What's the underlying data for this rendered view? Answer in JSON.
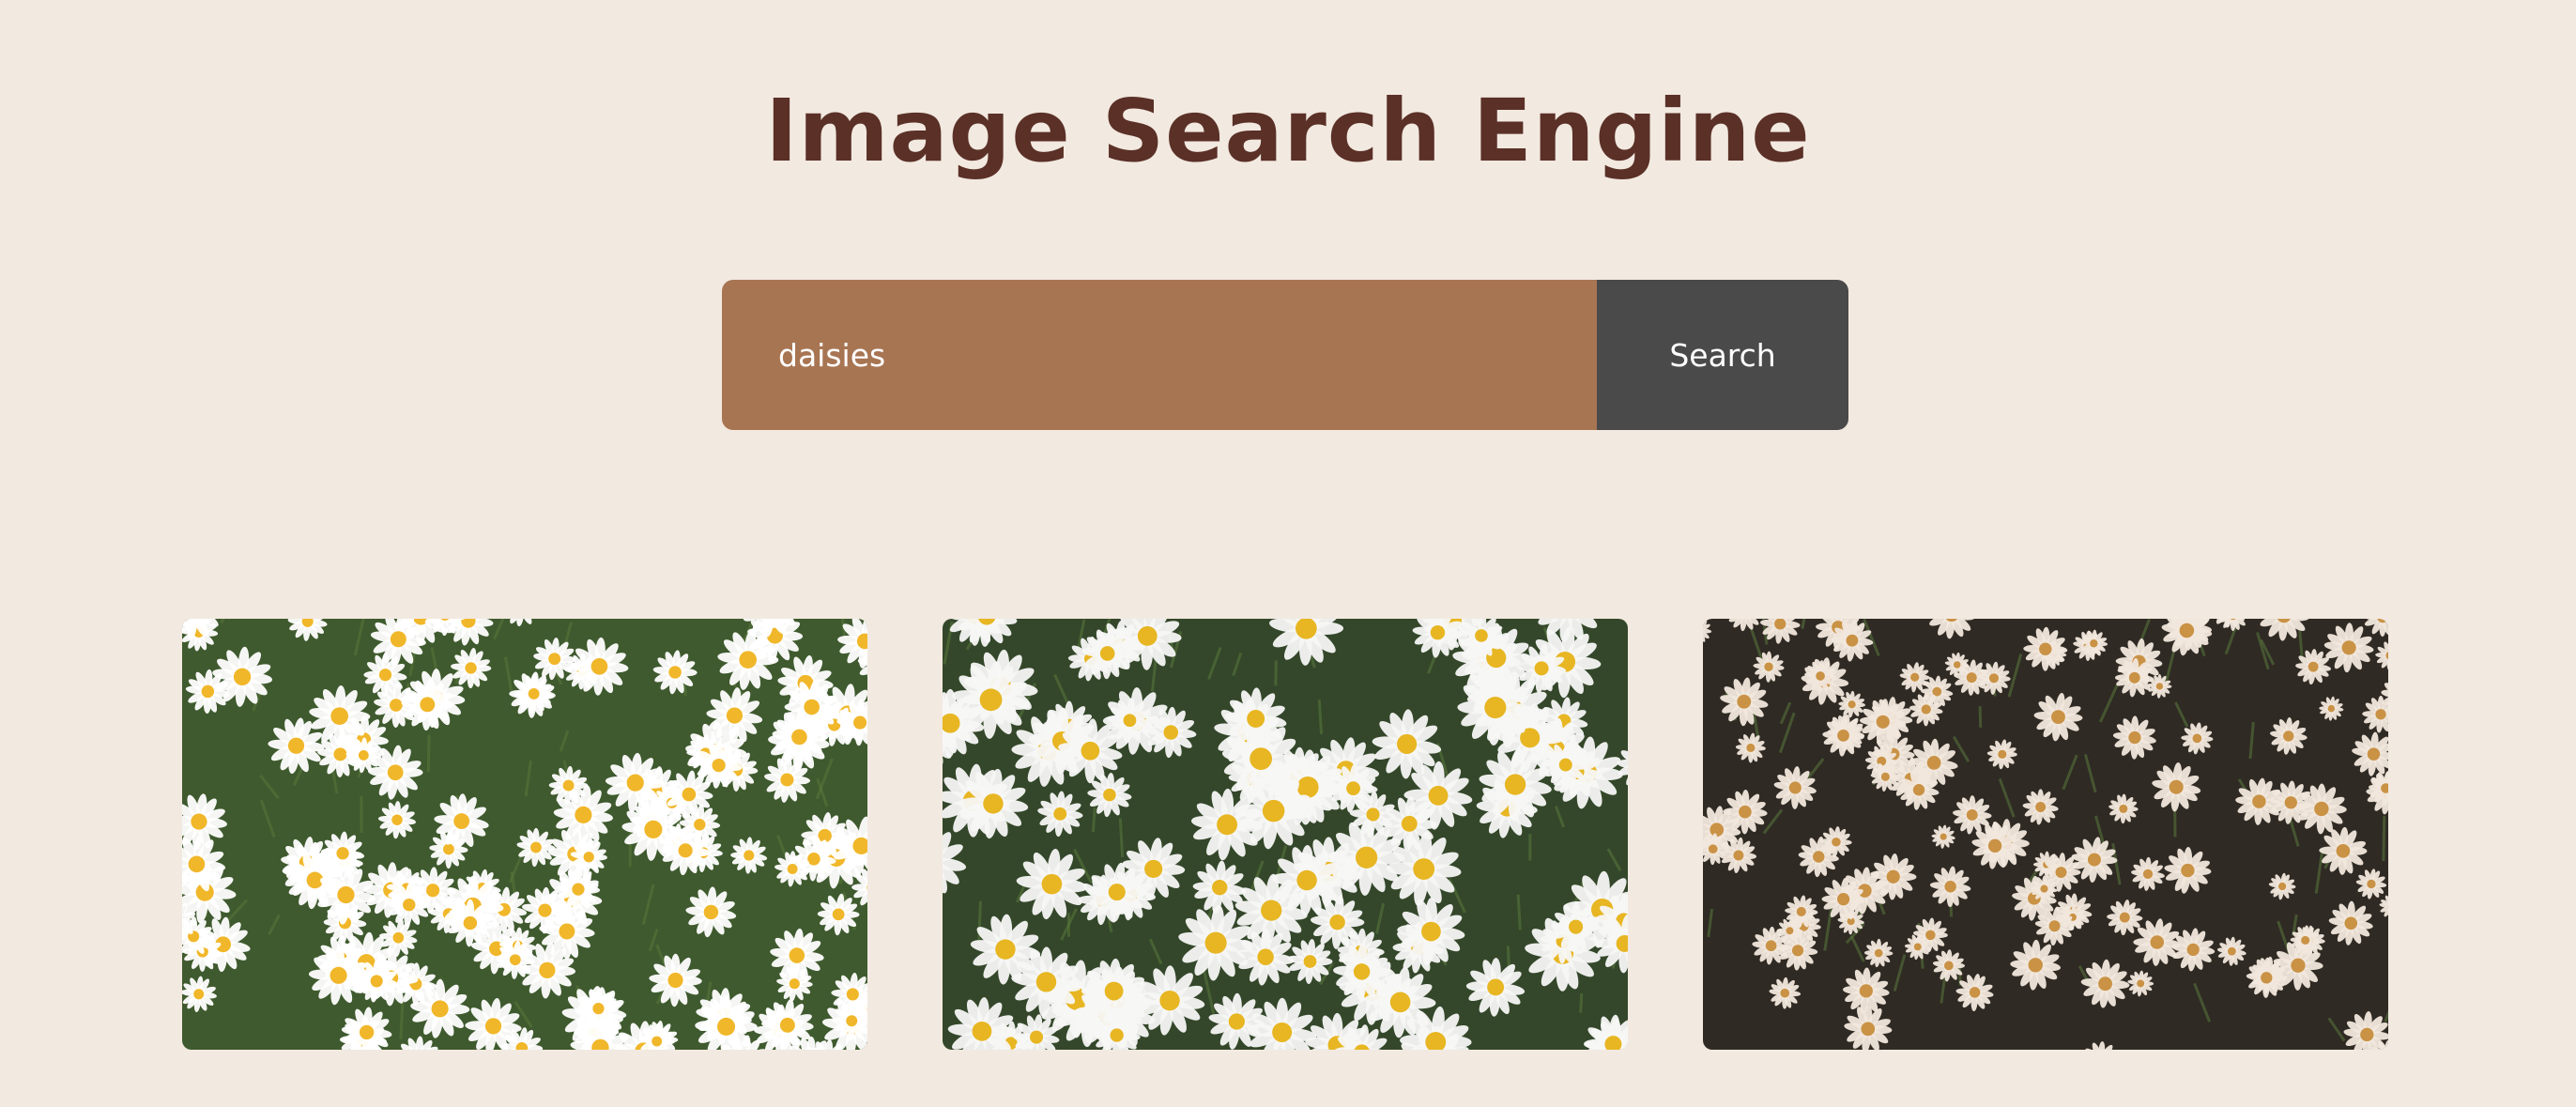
{
  "header": {
    "title": "Image Search Engine"
  },
  "search": {
    "value": "daisies",
    "button_label": "Search"
  },
  "results": [
    {
      "kind": "daisy-field-green",
      "background": "#3f5a2e",
      "petal": "#ffffff",
      "center": "#f1b72a"
    },
    {
      "kind": "daisy-cluster-bright",
      "background": "#34472a",
      "petal": "#f7f7f5",
      "center": "#e7b622"
    },
    {
      "kind": "daisy-field-dark",
      "background": "#2f2a24",
      "petal": "#f1e7dc",
      "center": "#c99245"
    }
  ],
  "colors": {
    "page_background": "#f2e9e0",
    "title": "#5a3027",
    "input_background": "#a87553",
    "button_background": "#4a4a4a"
  }
}
